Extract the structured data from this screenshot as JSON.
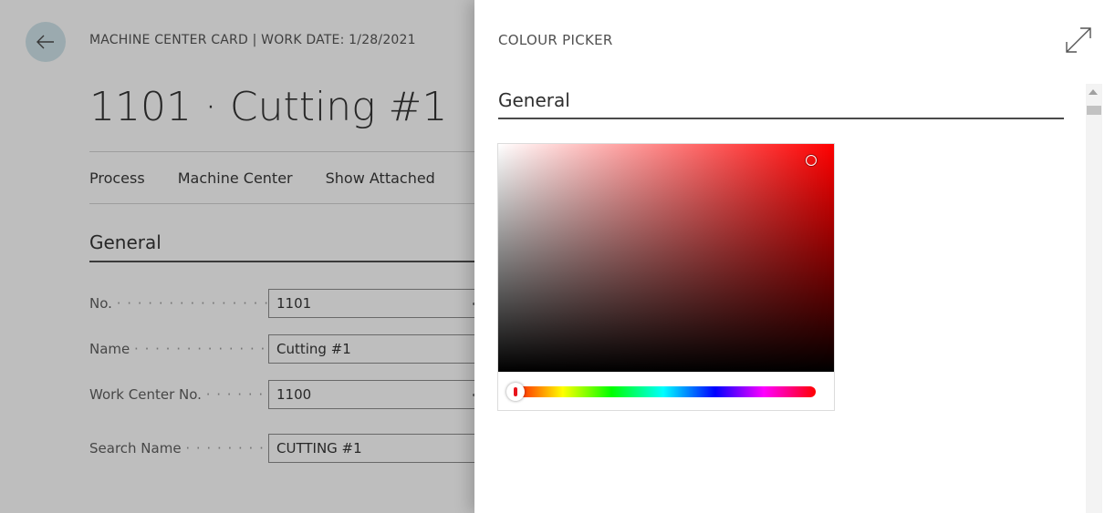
{
  "card": {
    "caption": "MACHINE CENTER CARD | WORK DATE: 1/28/2021",
    "title": "1101 · Cutting #1",
    "actions": [
      "Process",
      "Machine Center",
      "Show Attached"
    ],
    "section_title": "General",
    "fields": [
      {
        "label": "No.",
        "value": "1101"
      },
      {
        "label": "Name",
        "value": "Cutting #1"
      },
      {
        "label": "Work Center No.",
        "value": "1100"
      },
      {
        "label": "Search Name",
        "value": "CUTTING #1"
      }
    ],
    "icons": {
      "back": "arrow-left-icon"
    }
  },
  "panel": {
    "title": "COLOUR PICKER",
    "section_title": "General",
    "icons": {
      "expand": "expand-icon"
    },
    "color_picker": {
      "hue": "#ff0000",
      "selected_color": "#e8141c"
    }
  }
}
